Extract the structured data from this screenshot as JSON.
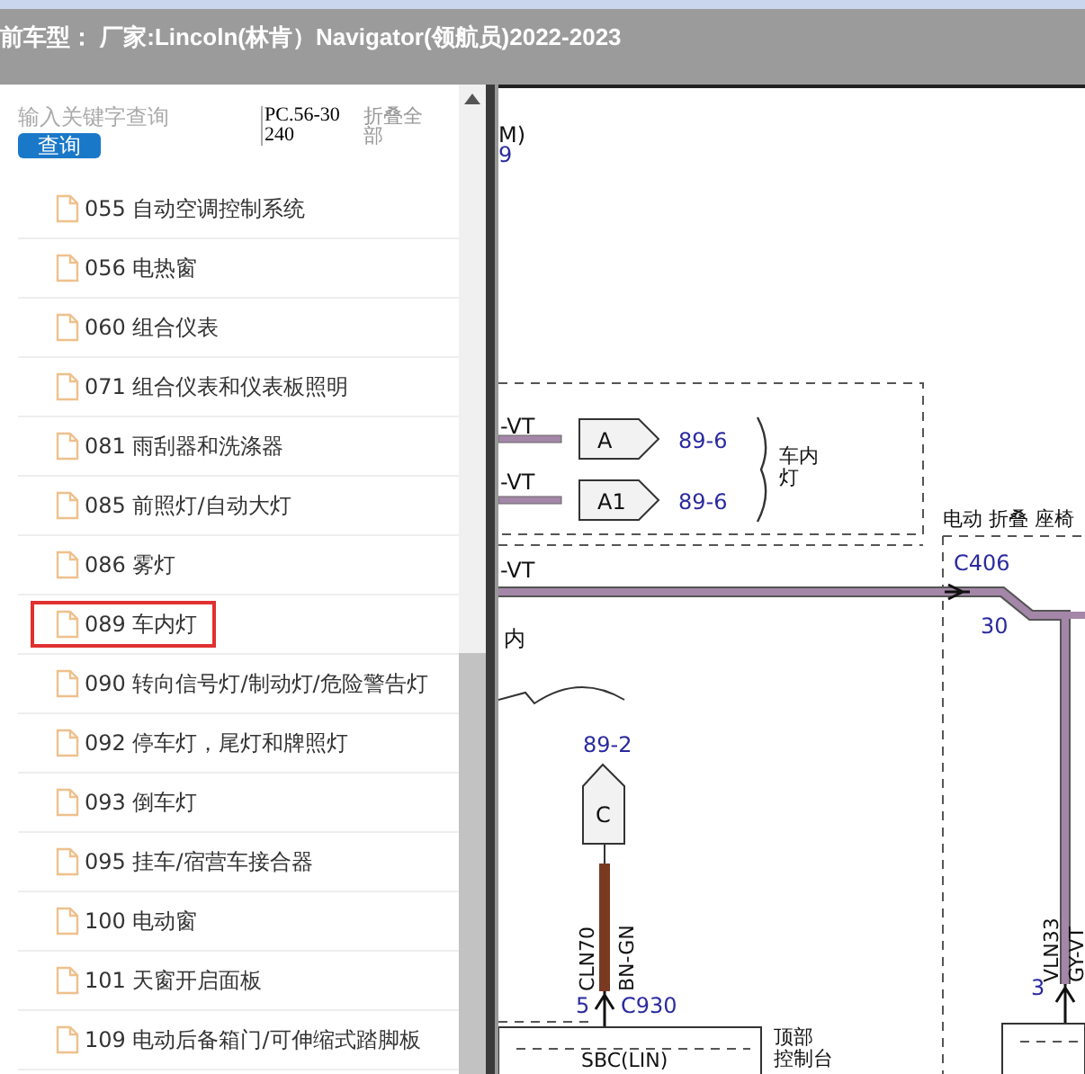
{
  "header": {
    "title": "前车型： 厂家:Lincoln(林肯）Navigator(领航员)2022-2023"
  },
  "search": {
    "placeholder": "输入关键字查询",
    "button": "查询",
    "code": "PC.56-30240",
    "collapse_all": "折叠全部"
  },
  "items": [
    {
      "label": "055 自动空调控制系统",
      "selected": false
    },
    {
      "label": "056 电热窗",
      "selected": false
    },
    {
      "label": "060 组合仪表",
      "selected": false
    },
    {
      "label": "071 组合仪表和仪表板照明",
      "selected": false
    },
    {
      "label": "081 雨刮器和洗涤器",
      "selected": false
    },
    {
      "label": "085 前照灯/自动大灯",
      "selected": false
    },
    {
      "label": "086 雾灯",
      "selected": false
    },
    {
      "label": "089 车内灯",
      "selected": true
    },
    {
      "label": "090 转向信号灯/制动灯/危险警告灯",
      "selected": false
    },
    {
      "label": "092 停车灯，尾灯和牌照灯",
      "selected": false
    },
    {
      "label": "093 倒车灯",
      "selected": false
    },
    {
      "label": "095 挂车/宿营车接合器",
      "selected": false
    },
    {
      "label": "100 电动窗",
      "selected": false
    },
    {
      "label": "101 天窗开启面板",
      "selected": false
    },
    {
      "label": "109 电动后备箱门/可伸缩式踏脚板",
      "selected": false
    }
  ],
  "diagram": {
    "top_fragment": "M)",
    "top_number": "9",
    "wire_labels": [
      "-VT",
      "-VT",
      "-VT"
    ],
    "connectors": [
      {
        "label": "A",
        "ref": "89-6"
      },
      {
        "label": "A1",
        "ref": "89-6"
      }
    ],
    "group_label": [
      "车内",
      "灯"
    ],
    "seat_label": "电动 折叠 座椅",
    "c406": {
      "name": "C406",
      "pin": "30"
    },
    "fragment": "内",
    "connector_c": {
      "ref": "89-2",
      "label": "C"
    },
    "wire_c": {
      "circuit": "CLN70",
      "color_code": "BN-GN"
    },
    "c930": {
      "pin": "5",
      "name": "C930"
    },
    "module": {
      "name": "SBC(LIN)",
      "label": [
        "顶部",
        "控制台"
      ]
    },
    "wire_v": {
      "circuit": "VLN33",
      "color_code": "GY-VT",
      "pin": "3"
    }
  }
}
